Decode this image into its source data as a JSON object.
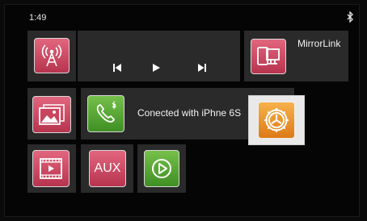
{
  "status_bar": {
    "time": "1:49",
    "bluetooth_icon": "bluetooth-icon"
  },
  "radio": {
    "icon": "radio-tower-icon"
  },
  "media": {
    "prev_icon": "skip-previous-icon",
    "play_icon": "play-icon",
    "next_icon": "skip-next-icon"
  },
  "mirrorlink": {
    "label": "MirrorLink",
    "icon": "mirrorlink-screens-icon"
  },
  "gallery": {
    "icon": "photo-gallery-icon"
  },
  "phone": {
    "status_text": "Conected with iPhne 6S",
    "icon": "phone-bluetooth-icon"
  },
  "settings": {
    "icon": "gear-settings-icon"
  },
  "video": {
    "icon": "video-player-icon"
  },
  "aux": {
    "label": "AUX"
  },
  "carplay": {
    "icon": "carplay-play-icon"
  },
  "colors": {
    "pink_tile": "#c9455f",
    "green_tile": "#5aa935",
    "orange_tile": "#ec9a2e",
    "panel": "#2a2a2a"
  }
}
